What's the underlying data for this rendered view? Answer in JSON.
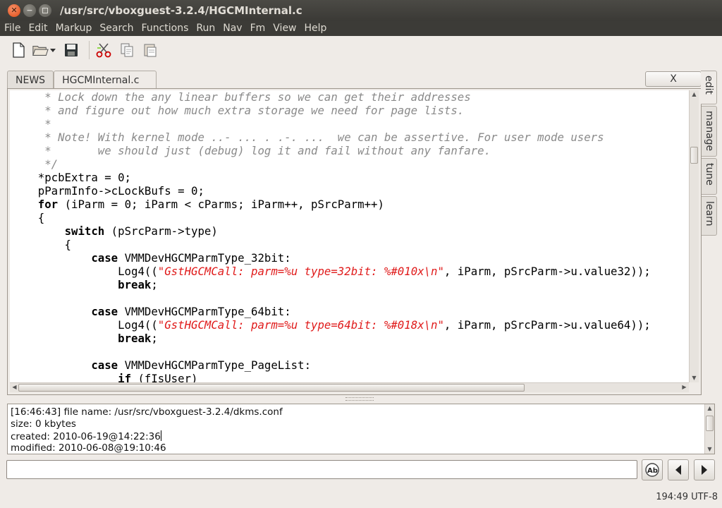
{
  "window": {
    "title": "/usr/src/vboxguest-3.2.4/HGCMInternal.c"
  },
  "menubar": [
    "File",
    "Edit",
    "Markup",
    "Search",
    "Functions",
    "Run",
    "Nav",
    "Fm",
    "View",
    "Help"
  ],
  "toolbar": {
    "icons": [
      "new-file-icon",
      "open-folder-icon",
      "dropdown-arrow-icon",
      "save-icon",
      "cut-icon",
      "copy-icon",
      "paste-icon"
    ]
  },
  "editor": {
    "tabs": [
      "NEWS",
      "HGCMInternal.c"
    ],
    "active_tab": "HGCMInternal.c",
    "close_label": "X",
    "code_lines": [
      "     * Lock down the any linear buffers so we can get their addresses",
      "     * and figure out how much extra storage we need for page lists.",
      "     *",
      "     * Note! With kernel mode ..- ... . .-. ...  we can be assertive. For user mode users",
      "     *       we should just (debug) log it and fail without any fanfare.",
      "     */",
      "    *pcbExtra = 0;",
      "    pParmInfo->cLockBufs = 0;",
      "    for (iParm = 0; iParm < cParms; iParm++, pSrcParm++)",
      "    {",
      "        switch (pSrcParm->type)",
      "        {",
      "            case VMMDevHGCMParmType_32bit:",
      "                Log4((\"GstHGCMCall: parm=%u type=32bit: %#010x\\n\", iParm, pSrcParm->u.value32));",
      "                break;",
      "",
      "            case VMMDevHGCMParmType_64bit:",
      "                Log4((\"GstHGCMCall: parm=%u type=64bit: %#018x\\n\", iParm, pSrcParm->u.value64));",
      "                break;",
      "",
      "            case VMMDevHGCMParmType_PageList:",
      "                if (fIsUser)"
    ]
  },
  "side_tabs": [
    "edit",
    "manage",
    "tune",
    "learn"
  ],
  "messages": {
    "lines": [
      "[16:46:43] file name: /usr/src/vboxguest-3.2.4/dkms.conf",
      "size: 0 kbytes",
      "created: 2010-06-19@14:22:36",
      "modified: 2010-06-08@19:10:46"
    ]
  },
  "command": {
    "value": "",
    "buttons": [
      "regex-toggle-icon",
      "prev-arrow-icon",
      "next-arrow-icon"
    ]
  },
  "status": {
    "position_encoding": "194:49 UTF-8"
  },
  "colors": {
    "comment": "#8a8a8a",
    "string": "#e01b1b",
    "titlebar": "#3c3b37",
    "close_button": "#df4a14"
  }
}
